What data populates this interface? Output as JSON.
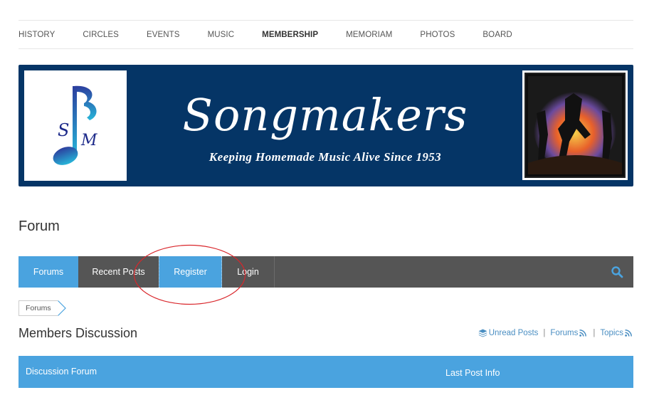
{
  "site_nav": {
    "items": [
      {
        "label": "HISTORY"
      },
      {
        "label": "CIRCLES"
      },
      {
        "label": "EVENTS"
      },
      {
        "label": "MUSIC"
      },
      {
        "label": "MEMBERSHIP",
        "active": true
      },
      {
        "label": "MEMORIAM"
      },
      {
        "label": "PHOTOS"
      },
      {
        "label": "BOARD"
      }
    ]
  },
  "banner": {
    "title": "Songmakers",
    "tagline": "Keeping Homemade Music Alive Since 1953",
    "logo_letters": "SM",
    "background": "#053566"
  },
  "page": {
    "title": "Forum"
  },
  "forum_bar": {
    "forums": "Forums",
    "recent_posts": "Recent Posts",
    "register": "Register",
    "login": "Login",
    "search_icon": "search-icon"
  },
  "breadcrumb": {
    "label": "Forums"
  },
  "section": {
    "title": "Members Discussion"
  },
  "feeds": {
    "unread": "Unread Posts",
    "forums": "Forums",
    "topics": "Topics",
    "separator": "|"
  },
  "table": {
    "col_forum": "Discussion Forum",
    "col_last_post": "Last Post Info"
  },
  "colors": {
    "accent": "#4aa3df",
    "bar": "#555555",
    "link": "#4a8ec2",
    "annotation": "#d9262b"
  }
}
